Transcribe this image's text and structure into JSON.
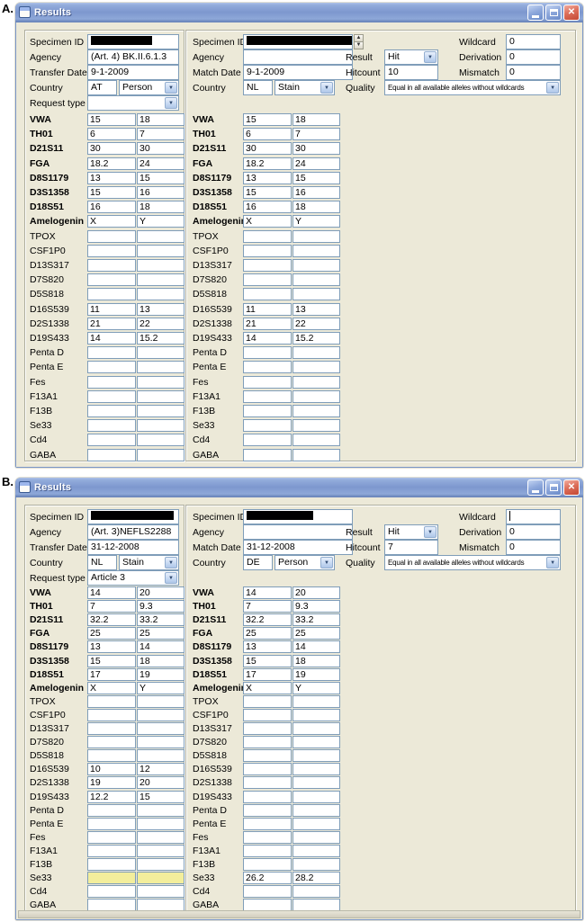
{
  "icons": {
    "combo_arrow": "▼",
    "spinner_up": "▲",
    "spinner_down": "▼",
    "close_glyph": "✕"
  },
  "colors": {
    "titlebar_blue": "#7D97CE",
    "close_button_red": "#DD6F5B",
    "window_face": "#ECE9D8",
    "field_border": "#7F9DB9",
    "highlight_yellow": "#F3EE9C",
    "redaction_black": "#000000"
  },
  "windows": [
    {
      "figure_label": "A.",
      "title": "Results",
      "left": {
        "specimen_label": "Specimen ID",
        "specimen_value": "",
        "specimen_redacted": true,
        "agency_label": "Agency",
        "agency_value": "(Art. 4) BK.II.6.1.3",
        "date_label": "Transfer Date",
        "date_value": "9-1-2009",
        "country_label": "Country",
        "country_code": "AT",
        "country_kind": "Person",
        "request_label": "Request type",
        "request_value": ""
      },
      "right": {
        "specimen_label": "Specimen ID",
        "specimen_value": "",
        "specimen_redacted": true,
        "agency_label": "Agency",
        "agency_value": "",
        "date_label": "Match Date",
        "date_value": "9-1-2009",
        "country_label": "Country",
        "country_code": "NL",
        "country_kind": "Stain"
      },
      "match": {
        "result_label": "Result",
        "result_value": "Hit",
        "hitcount_label": "Hitcount",
        "hitcount_value": "10",
        "quality_label": "Quality",
        "quality_value": "Equal in all available alleles without wildcards",
        "wildcard_label": "Wildcard",
        "wildcard_value": "0",
        "derivation_label": "Derivation",
        "derivation_value": "0",
        "mismatch_label": "Mismatch",
        "mismatch_value": "0"
      },
      "loci": [
        {
          "name": "VWA",
          "bold": true,
          "left": [
            "15",
            "18"
          ],
          "right": [
            "15",
            "18"
          ]
        },
        {
          "name": "TH01",
          "bold": true,
          "left": [
            "6",
            "7"
          ],
          "right": [
            "6",
            "7"
          ]
        },
        {
          "name": "D21S11",
          "bold": true,
          "left": [
            "30",
            "30"
          ],
          "right": [
            "30",
            "30"
          ]
        },
        {
          "name": "FGA",
          "bold": true,
          "left": [
            "18.2",
            "24"
          ],
          "right": [
            "18.2",
            "24"
          ]
        },
        {
          "name": "D8S1179",
          "bold": true,
          "left": [
            "13",
            "15"
          ],
          "right": [
            "13",
            "15"
          ]
        },
        {
          "name": "D3S1358",
          "bold": true,
          "left": [
            "15",
            "16"
          ],
          "right": [
            "15",
            "16"
          ]
        },
        {
          "name": "D18S51",
          "bold": true,
          "left": [
            "16",
            "18"
          ],
          "right": [
            "16",
            "18"
          ]
        },
        {
          "name": "Amelogenin",
          "bold": true,
          "left": [
            "X",
            "Y"
          ],
          "right": [
            "X",
            "Y"
          ]
        },
        {
          "name": "TPOX",
          "left": [
            "",
            ""
          ],
          "right": [
            "",
            ""
          ]
        },
        {
          "name": "CSF1P0",
          "left": [
            "",
            ""
          ],
          "right": [
            "",
            ""
          ]
        },
        {
          "name": "D13S317",
          "left": [
            "",
            ""
          ],
          "right": [
            "",
            ""
          ]
        },
        {
          "name": "D7S820",
          "left": [
            "",
            ""
          ],
          "right": [
            "",
            ""
          ]
        },
        {
          "name": "D5S818",
          "left": [
            "",
            ""
          ],
          "right": [
            "",
            ""
          ]
        },
        {
          "name": "D16S539",
          "left": [
            "11",
            "13"
          ],
          "right": [
            "11",
            "13"
          ]
        },
        {
          "name": "D2S1338",
          "left": [
            "21",
            "22"
          ],
          "right": [
            "21",
            "22"
          ]
        },
        {
          "name": "D19S433",
          "left": [
            "14",
            "15.2"
          ],
          "right": [
            "14",
            "15.2"
          ]
        },
        {
          "name": "Penta D",
          "left": [
            "",
            ""
          ],
          "right": [
            "",
            ""
          ]
        },
        {
          "name": "Penta E",
          "left": [
            "",
            ""
          ],
          "right": [
            "",
            ""
          ]
        },
        {
          "name": "Fes",
          "left": [
            "",
            ""
          ],
          "right": [
            "",
            ""
          ]
        },
        {
          "name": "F13A1",
          "left": [
            "",
            ""
          ],
          "right": [
            "",
            ""
          ]
        },
        {
          "name": "F13B",
          "left": [
            "",
            ""
          ],
          "right": [
            "",
            ""
          ]
        },
        {
          "name": "Se33",
          "left": [
            "",
            ""
          ],
          "right": [
            "",
            ""
          ]
        },
        {
          "name": "Cd4",
          "left": [
            "",
            ""
          ],
          "right": [
            "",
            ""
          ]
        },
        {
          "name": "GABA",
          "left": [
            "",
            ""
          ],
          "right": [
            "",
            ""
          ]
        }
      ]
    },
    {
      "figure_label": "B.",
      "title": "Results",
      "left": {
        "specimen_label": "Specimen ID",
        "specimen_value": "",
        "specimen_redacted": true,
        "agency_label": "Agency",
        "agency_value": "(Art. 3)NEFLS2288",
        "date_label": "Transfer Date",
        "date_value": "31-12-2008",
        "country_label": "Country",
        "country_code": "NL",
        "country_kind": "Stain",
        "request_label": "Request type",
        "request_value": "Article 3"
      },
      "right": {
        "specimen_label": "Specimen ID",
        "specimen_value": "",
        "specimen_redacted": true,
        "agency_label": "Agency",
        "agency_value": "",
        "date_label": "Match Date",
        "date_value": "31-12-2008",
        "country_label": "Country",
        "country_code": "DE",
        "country_kind": "Person"
      },
      "match": {
        "result_label": "Result",
        "result_value": "Hit",
        "hitcount_label": "Hitcount",
        "hitcount_value": "7",
        "quality_label": "Quality",
        "quality_value": "Equal in all available alleles without wildcards",
        "wildcard_label": "Wildcard",
        "wildcard_value": "",
        "derivation_label": "Derivation",
        "derivation_value": "0",
        "mismatch_label": "Mismatch",
        "mismatch_value": "0"
      },
      "loci": [
        {
          "name": "VWA",
          "bold": true,
          "left": [
            "14",
            "20"
          ],
          "right": [
            "14",
            "20"
          ]
        },
        {
          "name": "TH01",
          "bold": true,
          "left": [
            "7",
            "9.3"
          ],
          "right": [
            "7",
            "9.3"
          ]
        },
        {
          "name": "D21S11",
          "bold": true,
          "left": [
            "32.2",
            "33.2"
          ],
          "right": [
            "32.2",
            "33.2"
          ]
        },
        {
          "name": "FGA",
          "bold": true,
          "left": [
            "25",
            "25"
          ],
          "right": [
            "25",
            "25"
          ]
        },
        {
          "name": "D8S1179",
          "bold": true,
          "left": [
            "13",
            "14"
          ],
          "right": [
            "13",
            "14"
          ]
        },
        {
          "name": "D3S1358",
          "bold": true,
          "left": [
            "15",
            "18"
          ],
          "right": [
            "15",
            "18"
          ]
        },
        {
          "name": "D18S51",
          "bold": true,
          "left": [
            "17",
            "19"
          ],
          "right": [
            "17",
            "19"
          ]
        },
        {
          "name": "Amelogenin",
          "bold": true,
          "left": [
            "X",
            "Y"
          ],
          "right": [
            "X",
            "Y"
          ]
        },
        {
          "name": "TPOX",
          "left": [
            "",
            ""
          ],
          "right": [
            "",
            ""
          ]
        },
        {
          "name": "CSF1P0",
          "left": [
            "",
            ""
          ],
          "right": [
            "",
            ""
          ]
        },
        {
          "name": "D13S317",
          "left": [
            "",
            ""
          ],
          "right": [
            "",
            ""
          ]
        },
        {
          "name": "D7S820",
          "left": [
            "",
            ""
          ],
          "right": [
            "",
            ""
          ]
        },
        {
          "name": "D5S818",
          "left": [
            "",
            ""
          ],
          "right": [
            "",
            ""
          ]
        },
        {
          "name": "D16S539",
          "left": [
            "10",
            "12"
          ],
          "right": [
            "",
            ""
          ]
        },
        {
          "name": "D2S1338",
          "left": [
            "19",
            "20"
          ],
          "right": [
            "",
            ""
          ]
        },
        {
          "name": "D19S433",
          "left": [
            "12.2",
            "15"
          ],
          "right": [
            "",
            ""
          ]
        },
        {
          "name": "Penta D",
          "left": [
            "",
            ""
          ],
          "right": [
            "",
            ""
          ]
        },
        {
          "name": "Penta E",
          "left": [
            "",
            ""
          ],
          "right": [
            "",
            ""
          ]
        },
        {
          "name": "Fes",
          "left": [
            "",
            ""
          ],
          "right": [
            "",
            ""
          ]
        },
        {
          "name": "F13A1",
          "left": [
            "",
            ""
          ],
          "right": [
            "",
            ""
          ]
        },
        {
          "name": "F13B",
          "left": [
            "",
            ""
          ],
          "right": [
            "",
            ""
          ]
        },
        {
          "name": "Se33",
          "left": [
            "",
            ""
          ],
          "right": [
            "26.2",
            "28.2"
          ],
          "highlight_left": true
        },
        {
          "name": "Cd4",
          "left": [
            "",
            ""
          ],
          "right": [
            "",
            ""
          ]
        },
        {
          "name": "GABA",
          "left": [
            "",
            ""
          ],
          "right": [
            "",
            ""
          ]
        }
      ]
    }
  ]
}
